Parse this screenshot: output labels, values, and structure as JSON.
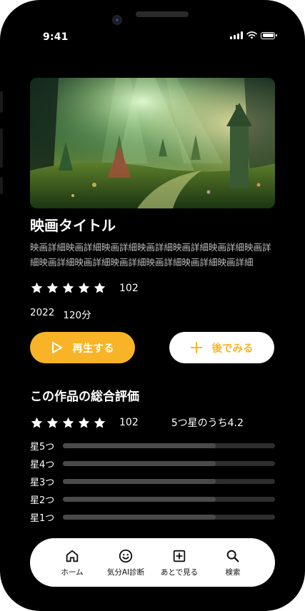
{
  "status_bar": {
    "time": "9:41"
  },
  "movie": {
    "title": "映画タイトル",
    "description": "映画詳細映画詳細映画詳細映画詳細映画詳細映画詳細映画詳細映画詳細映画詳細映画詳細映画詳細映画詳細映画詳細",
    "stars": 5,
    "rating_count": "102",
    "year": "2022",
    "duration": "120分"
  },
  "actions": {
    "play_label": "再生する",
    "later_label": "後でみる"
  },
  "review_summary": {
    "title": "この作品の総合評価",
    "stars": 5,
    "rating_count": "102",
    "average_text": "5つ星のうち4.2",
    "breakdown": [
      {
        "label": "星5つ",
        "fraction": 0.72
      },
      {
        "label": "星4つ",
        "fraction": 0.72
      },
      {
        "label": "星3つ",
        "fraction": 0.72
      },
      {
        "label": "星2つ",
        "fraction": 0.72
      },
      {
        "label": "星1つ",
        "fraction": 0.72
      }
    ]
  },
  "tab_bar": {
    "items": [
      {
        "label": "ホーム",
        "icon": "home-icon"
      },
      {
        "label": "気分AI診断",
        "icon": "smile-icon"
      },
      {
        "label": "あとで見る",
        "icon": "plus-square-icon"
      },
      {
        "label": "検索",
        "icon": "search-icon"
      }
    ]
  },
  "colors": {
    "accent": "#f8b426",
    "background": "#000000",
    "track": "#2e2e2e",
    "fill": "#4a4a4a"
  }
}
